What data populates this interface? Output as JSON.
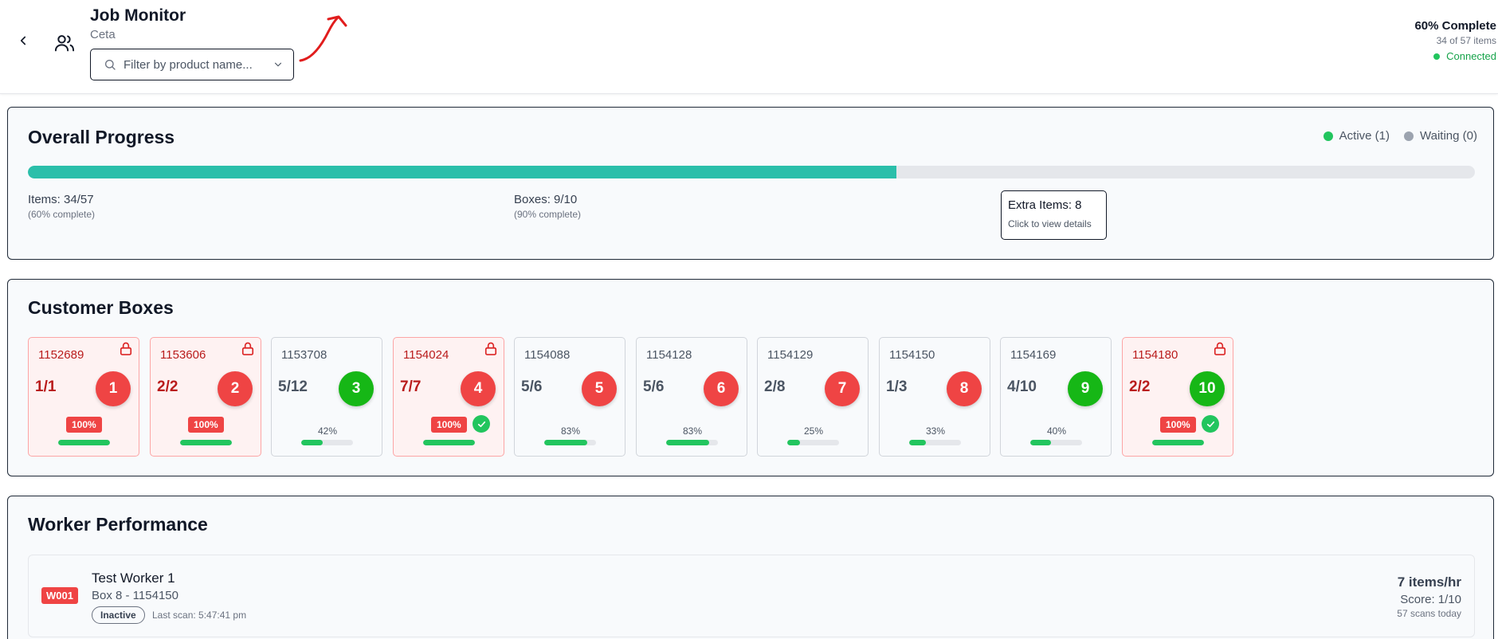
{
  "header": {
    "title": "Job Monitor",
    "subtitle": "Ceta",
    "filter_placeholder": "Filter by product name...",
    "completion": "60% Complete",
    "items_count": "34 of 57 items",
    "connection": "Connected"
  },
  "overall": {
    "title": "Overall Progress",
    "progress_fraction": 0.6,
    "legend": {
      "active": "Active (1)",
      "waiting": "Waiting (0)"
    },
    "items": "Items: 34/57",
    "items_sub": "(60% complete)",
    "boxes": "Boxes: 9/10",
    "boxes_sub": "(90% complete)",
    "extra": "Extra Items: 8",
    "extra_sub": "Click to view details"
  },
  "customer_boxes": {
    "title": "Customer Boxes",
    "boxes": [
      {
        "id": "1152689",
        "count": "1/1",
        "number": "1",
        "percent": "100%",
        "fill": 1.0,
        "complete": true,
        "locked": true,
        "checked": false,
        "circle_color": "#ef4444"
      },
      {
        "id": "1153606",
        "count": "2/2",
        "number": "2",
        "percent": "100%",
        "fill": 1.0,
        "complete": true,
        "locked": true,
        "checked": false,
        "circle_color": "#ef4444"
      },
      {
        "id": "1153708",
        "count": "5/12",
        "number": "3",
        "percent": "42%",
        "fill": 0.42,
        "complete": false,
        "locked": false,
        "checked": false,
        "circle_color": "#16b716"
      },
      {
        "id": "1154024",
        "count": "7/7",
        "number": "4",
        "percent": "100%",
        "fill": 1.0,
        "complete": true,
        "locked": true,
        "checked": true,
        "circle_color": "#ef4444"
      },
      {
        "id": "1154088",
        "count": "5/6",
        "number": "5",
        "percent": "83%",
        "fill": 0.83,
        "complete": false,
        "locked": false,
        "checked": false,
        "circle_color": "#ef4444"
      },
      {
        "id": "1154128",
        "count": "5/6",
        "number": "6",
        "percent": "83%",
        "fill": 0.83,
        "complete": false,
        "locked": false,
        "checked": false,
        "circle_color": "#ef4444"
      },
      {
        "id": "1154129",
        "count": "2/8",
        "number": "7",
        "percent": "25%",
        "fill": 0.25,
        "complete": false,
        "locked": false,
        "checked": false,
        "circle_color": "#ef4444"
      },
      {
        "id": "1154150",
        "count": "1/3",
        "number": "8",
        "percent": "33%",
        "fill": 0.33,
        "complete": false,
        "locked": false,
        "checked": false,
        "circle_color": "#ef4444"
      },
      {
        "id": "1154169",
        "count": "4/10",
        "number": "9",
        "percent": "40%",
        "fill": 0.4,
        "complete": false,
        "locked": false,
        "checked": false,
        "circle_color": "#16b716"
      },
      {
        "id": "1154180",
        "count": "2/2",
        "number": "10",
        "percent": "100%",
        "fill": 1.0,
        "complete": true,
        "locked": true,
        "checked": true,
        "circle_color": "#16b716"
      }
    ]
  },
  "workers": {
    "title": "Worker Performance",
    "list": [
      {
        "id": "W001",
        "name": "Test Worker 1",
        "box": "Box 8 - 1154150",
        "status": "Inactive",
        "last_scan": "Last scan: 5:47:41 pm",
        "rate": "7 items/hr",
        "score": "Score: 1/10",
        "scans": "57 scans today"
      }
    ]
  },
  "colors": {
    "accent_teal": "#2bbfaa",
    "active_green": "#22c55e",
    "waiting_gray": "#9ca3af",
    "danger_red": "#ef4444",
    "annotation_red": "#e11d1d"
  },
  "icons": [
    "chevron-left-icon",
    "users-icon",
    "search-icon",
    "chevron-down-icon",
    "lock-icon",
    "check-icon",
    "arrow-annotation-icon"
  ]
}
